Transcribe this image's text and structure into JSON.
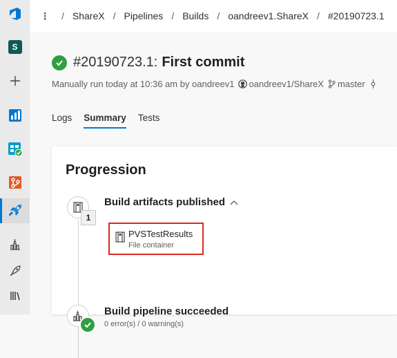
{
  "rail": {
    "items": [
      {
        "name": "azure-devops-logo"
      },
      {
        "name": "project-avatar",
        "label": "S"
      },
      {
        "name": "new"
      },
      {
        "name": "overview"
      },
      {
        "name": "boards"
      },
      {
        "name": "repos"
      },
      {
        "name": "pipelines"
      },
      {
        "name": "builds"
      },
      {
        "name": "releases"
      },
      {
        "name": "library"
      }
    ]
  },
  "header": {
    "breadcrumbs": [
      "ShareX",
      "Pipelines",
      "Builds",
      "oandreev1.ShareX",
      "#20190723.1"
    ]
  },
  "build": {
    "number": "#20190723.1:",
    "message": "First commit",
    "meta_prefix": "Manually run today at 10:36 am by oandreev1",
    "repo": "oandreev1/ShareX",
    "branch": "master"
  },
  "tabs": [
    "Logs",
    "Summary",
    "Tests"
  ],
  "progression": {
    "title": "Progression",
    "steps": [
      {
        "title": "Build artifacts published",
        "count": "1"
      },
      {
        "title": "Build pipeline succeeded",
        "subtitle": "0 error(s) / 0 warning(s)"
      }
    ],
    "artifact": {
      "name": "PVSTestResults",
      "type": "File container"
    }
  },
  "colors": {
    "accent": "#0078d4",
    "success": "#2f9e44",
    "highlight": "#d92a1f"
  }
}
